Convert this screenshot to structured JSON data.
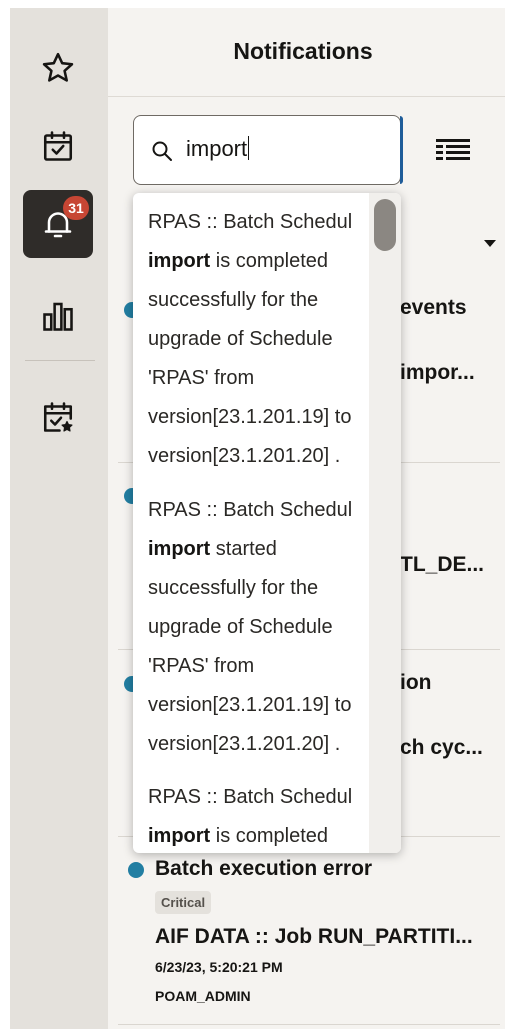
{
  "rail": {
    "notification_count": "31"
  },
  "panel": {
    "title": "Notifications"
  },
  "search": {
    "value": "import"
  },
  "notifications": [
    {
      "title": "events",
      "body": "impor..."
    },
    {
      "body": "TL_DE..."
    },
    {
      "title": "ion",
      "body": "ch cyc..."
    },
    {
      "title": "Batch execution error",
      "severity": "Critical",
      "body": "AIF DATA :: Job RUN_PARTITI...",
      "timestamp": "6/23/23, 5:20:21 PM",
      "user": "POAM_ADMIN"
    }
  ],
  "suggestions": [
    {
      "prefix": "RPAS :: Batch Schedul",
      "keyword": "import",
      "rest_first": " is completed",
      "lines": [
        "successfully for the",
        "upgrade of Schedule",
        "'RPAS' from",
        "version[23.1.201.19] to",
        "version[23.1.201.20] ."
      ]
    },
    {
      "prefix": "RPAS :: Batch Schedul",
      "keyword": "import",
      "rest_first": " started",
      "lines": [
        "successfully for the",
        "upgrade of Schedule",
        "'RPAS' from",
        "version[23.1.201.19] to",
        "version[23.1.201.20] ."
      ]
    },
    {
      "prefix": "RPAS :: Batch Schedul",
      "keyword": "import",
      "rest_first": " is completed",
      "lines": []
    }
  ],
  "colors": {
    "rail_bg": "#e4e1dc",
    "active_bg": "#2f2c29",
    "badge": "#c74634",
    "unread_dot": "#227ea2",
    "focus": "#1f5c99"
  },
  "icons": [
    "star-icon",
    "calendar-check-icon",
    "bell-icon",
    "bar-chart-icon",
    "calendar-star-icon",
    "search-icon",
    "list-view-icon",
    "chevron-down-icon"
  ]
}
